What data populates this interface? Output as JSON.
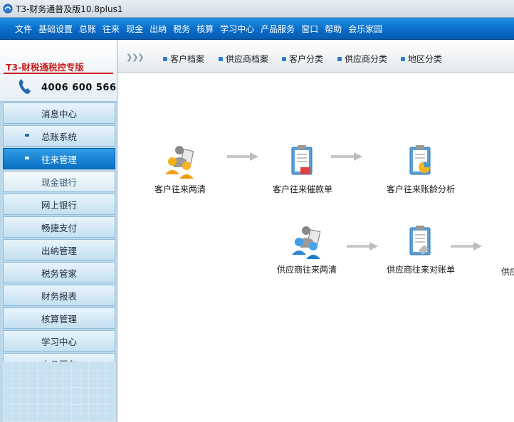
{
  "window": {
    "title": "T3-财务通普及版10.8plus1"
  },
  "menu": [
    "文件",
    "基础设置",
    "总账",
    "往来",
    "现金",
    "出纳",
    "税务",
    "核算",
    "学习中心",
    "产品服务",
    "窗口",
    "帮助",
    "会乐家园"
  ],
  "sidebar": {
    "logo": {
      "text": "T3-财税通税控专版",
      "phone": "4006 600 566"
    },
    "items": [
      {
        "label": "消息中心"
      },
      {
        "label": "总账系统"
      },
      {
        "label": "往来管理"
      },
      {
        "label": "现金银行"
      },
      {
        "label": "网上银行"
      },
      {
        "label": "畅捷支付"
      },
      {
        "label": "出纳管理"
      },
      {
        "label": "税务管家"
      },
      {
        "label": "财务报表"
      },
      {
        "label": "核算管理"
      },
      {
        "label": "学习中心"
      },
      {
        "label": "产品服务"
      }
    ]
  },
  "tabs": [
    "客户档案",
    "供应商档案",
    "客户分类",
    "供应商分类",
    "地区分类"
  ],
  "flow": {
    "customer_row": [
      {
        "label": "客户往来两清",
        "icon": "people-icon"
      },
      {
        "label": "客户往来催款单",
        "icon": "clipboard-icon"
      },
      {
        "label": "客户往来账龄分析",
        "icon": "clipboard-chart-icon"
      }
    ],
    "supplier_row": [
      {
        "label": "供应商往来两清",
        "icon": "people-icon"
      },
      {
        "label": "供应商往来对账单",
        "icon": "clipboard-icon"
      },
      {
        "label": "供应",
        "icon": ""
      }
    ]
  },
  "colors": {
    "menubar": "#0a6cc8",
    "active_nav": "#1a85d6",
    "sidebar_bg": "#bcd9ec"
  }
}
